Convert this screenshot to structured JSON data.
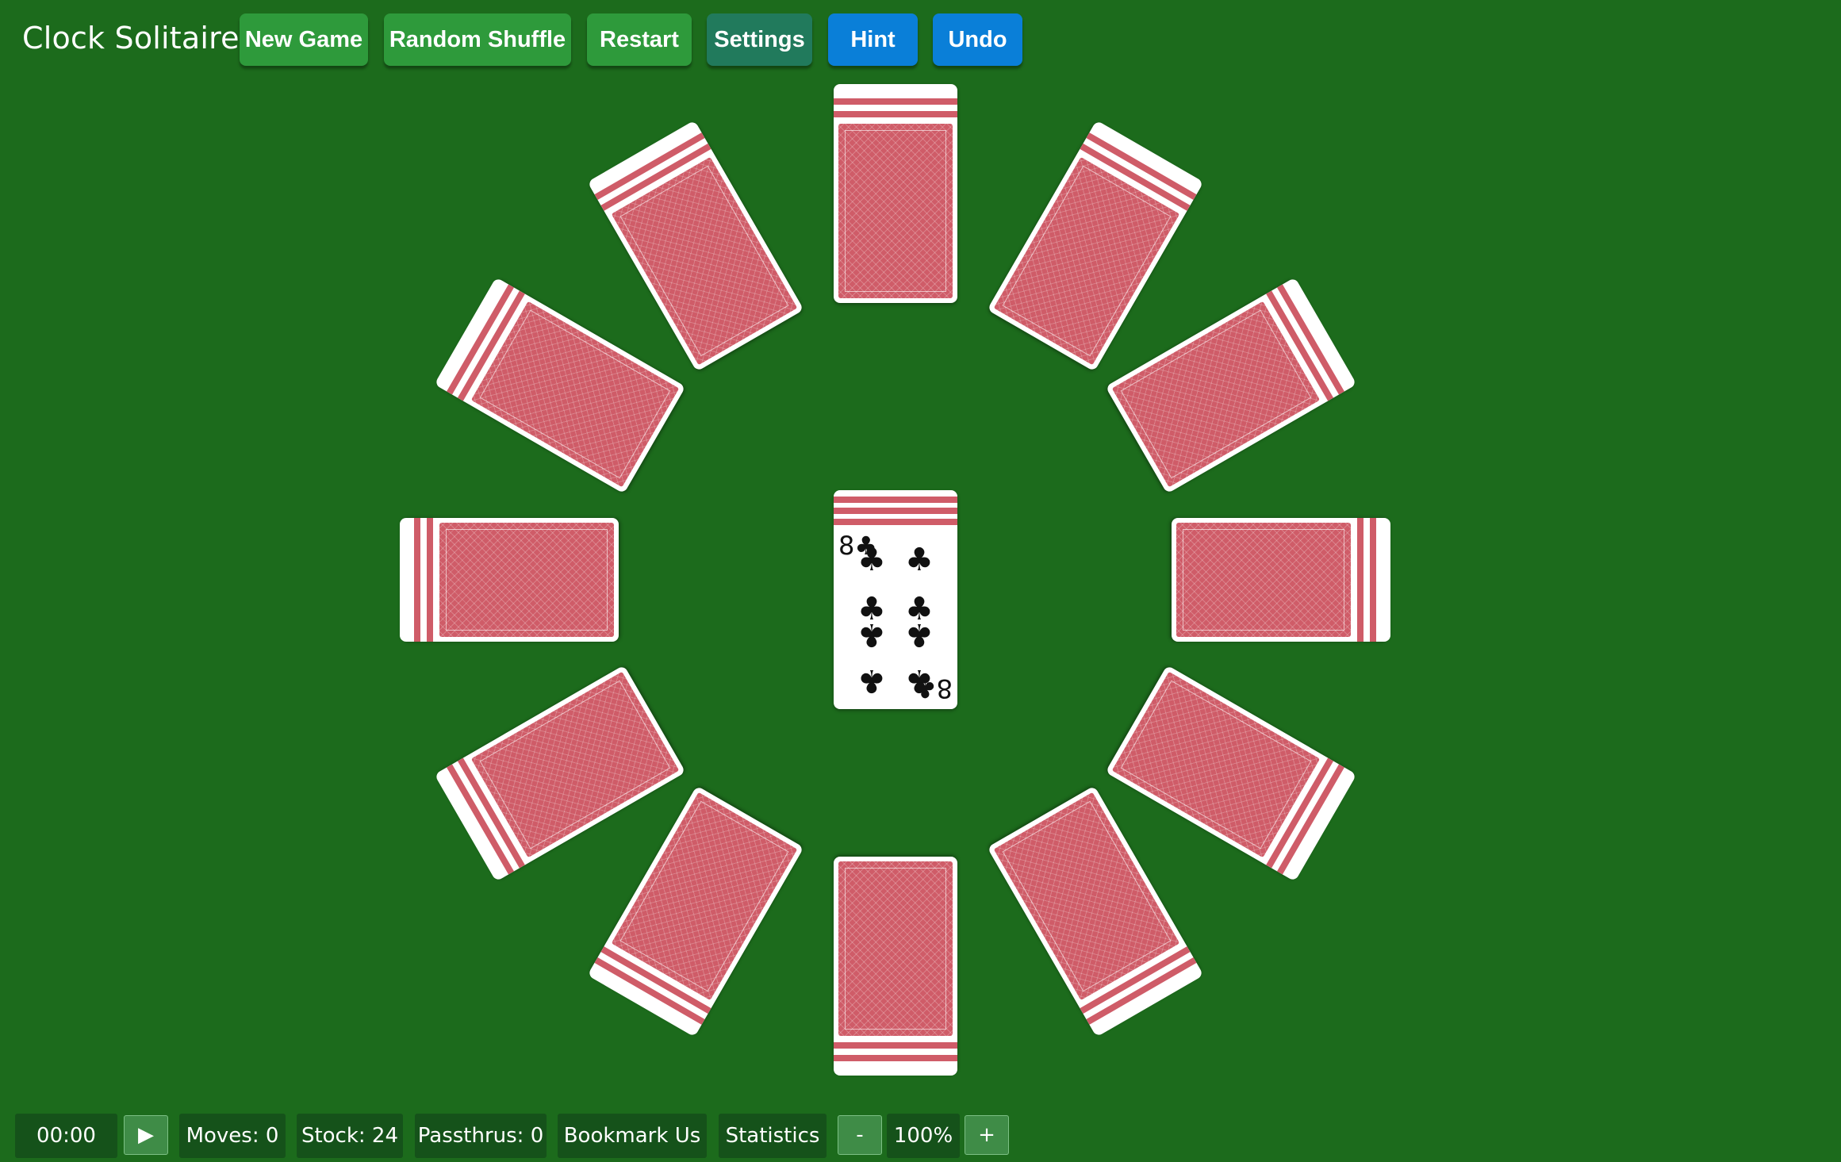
{
  "app": {
    "title": "Clock Solitaire"
  },
  "toolbar": {
    "new_game": "New Game",
    "random_shuffle": "Random Shuffle",
    "restart": "Restart",
    "settings": "Settings",
    "hint": "Hint",
    "undo": "Undo"
  },
  "center_card": {
    "rank": "8",
    "suit": "♣",
    "corner": "8♣"
  },
  "status": {
    "timer": "00:00",
    "play_icon": "▶",
    "moves": "Moves: 0",
    "stock": "Stock: 24",
    "passthrus": "Passthrus: 0",
    "bookmark": "Bookmark Us",
    "statistics": "Statistics",
    "zoom_out": "-",
    "zoom": "100%",
    "zoom_in": "+"
  },
  "colors": {
    "felt": "#1c6b1c",
    "card_back": "#cf5c68",
    "button_green": "#2e9a3b",
    "button_teal": "#217a5c",
    "button_blue": "#0a7fd8"
  }
}
